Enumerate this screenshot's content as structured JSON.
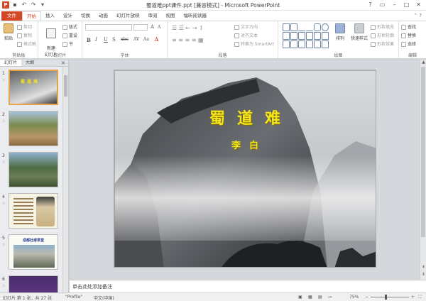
{
  "titlebar": {
    "title": "蜀道难ppt课件.ppt [兼容模式] - Microsoft PowerPoint",
    "app_icon_letter": "P"
  },
  "tabs": [
    "文件",
    "开始",
    "插入",
    "设计",
    "切换",
    "动画",
    "幻灯片放映",
    "审阅",
    "视图",
    "福昕阅读器"
  ],
  "ribbon": {
    "clipboard": {
      "label": "剪贴板",
      "paste": "粘贴",
      "cut": "剪切",
      "copy": "复制",
      "format_painter": "格式刷"
    },
    "slides": {
      "label": "幻灯片",
      "new_slide": "新建\n幻灯片",
      "layout": "版式",
      "reset": "重设",
      "section": "节"
    },
    "font": {
      "label": "字体",
      "bold": "B",
      "italic": "I",
      "underline": "U",
      "strike": "S",
      "abc": "abc",
      "spacing": "AV",
      "case": "Aa",
      "grow": "A",
      "shrink": "A"
    },
    "paragraph": {
      "label": "段落",
      "text_direction": "文字方向",
      "align_text": "对齐文本",
      "smartart": "转换为 SmartArt"
    },
    "drawing": {
      "label": "绘图",
      "arrange": "排列",
      "quick_styles": "快速样式",
      "shape_fill": "形状填充",
      "shape_outline": "形状轮廓",
      "shape_effects": "形状效果"
    },
    "editing": {
      "label": "编辑",
      "find": "查找",
      "replace": "替换",
      "select": "选择"
    }
  },
  "leftpane": {
    "tabs": [
      "幻灯片",
      "大纲"
    ],
    "slides": [
      {
        "num": "1",
        "selected": true
      },
      {
        "num": "2",
        "selected": false
      },
      {
        "num": "3",
        "selected": false
      },
      {
        "num": "4",
        "selected": false
      },
      {
        "num": "5",
        "selected": false
      },
      {
        "num": "6",
        "selected": false
      }
    ],
    "slide5_caption": "成都杜甫草堂"
  },
  "slide": {
    "title": "蜀道难",
    "subtitle": "李白"
  },
  "notes": {
    "placeholder": "单击此处添加备注"
  },
  "statusbar": {
    "slide_info": "幻灯片 第 1 张，共 27 张",
    "theme": "\"Profile\"",
    "language": "中文(中国)",
    "zoom": "75%"
  }
}
